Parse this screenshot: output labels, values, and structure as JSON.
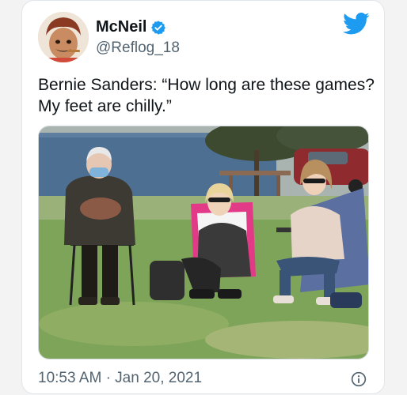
{
  "tweet": {
    "display_name": "McNeil",
    "handle": "@Reflog_18",
    "text_lines": [
      "Bernie Sanders: “How long are these games?",
      "My feet are chilly.”"
    ],
    "time": "10:53 AM",
    "separator": "·",
    "date": "Jan 20, 2021"
  },
  "icons": {
    "verified": "verified-badge-icon",
    "logo": "twitter-bird-icon",
    "info": "info-icon"
  },
  "colors": {
    "twitter_blue": "#1d9bf0",
    "text": "#0f1419",
    "secondary_text": "#536471"
  }
}
